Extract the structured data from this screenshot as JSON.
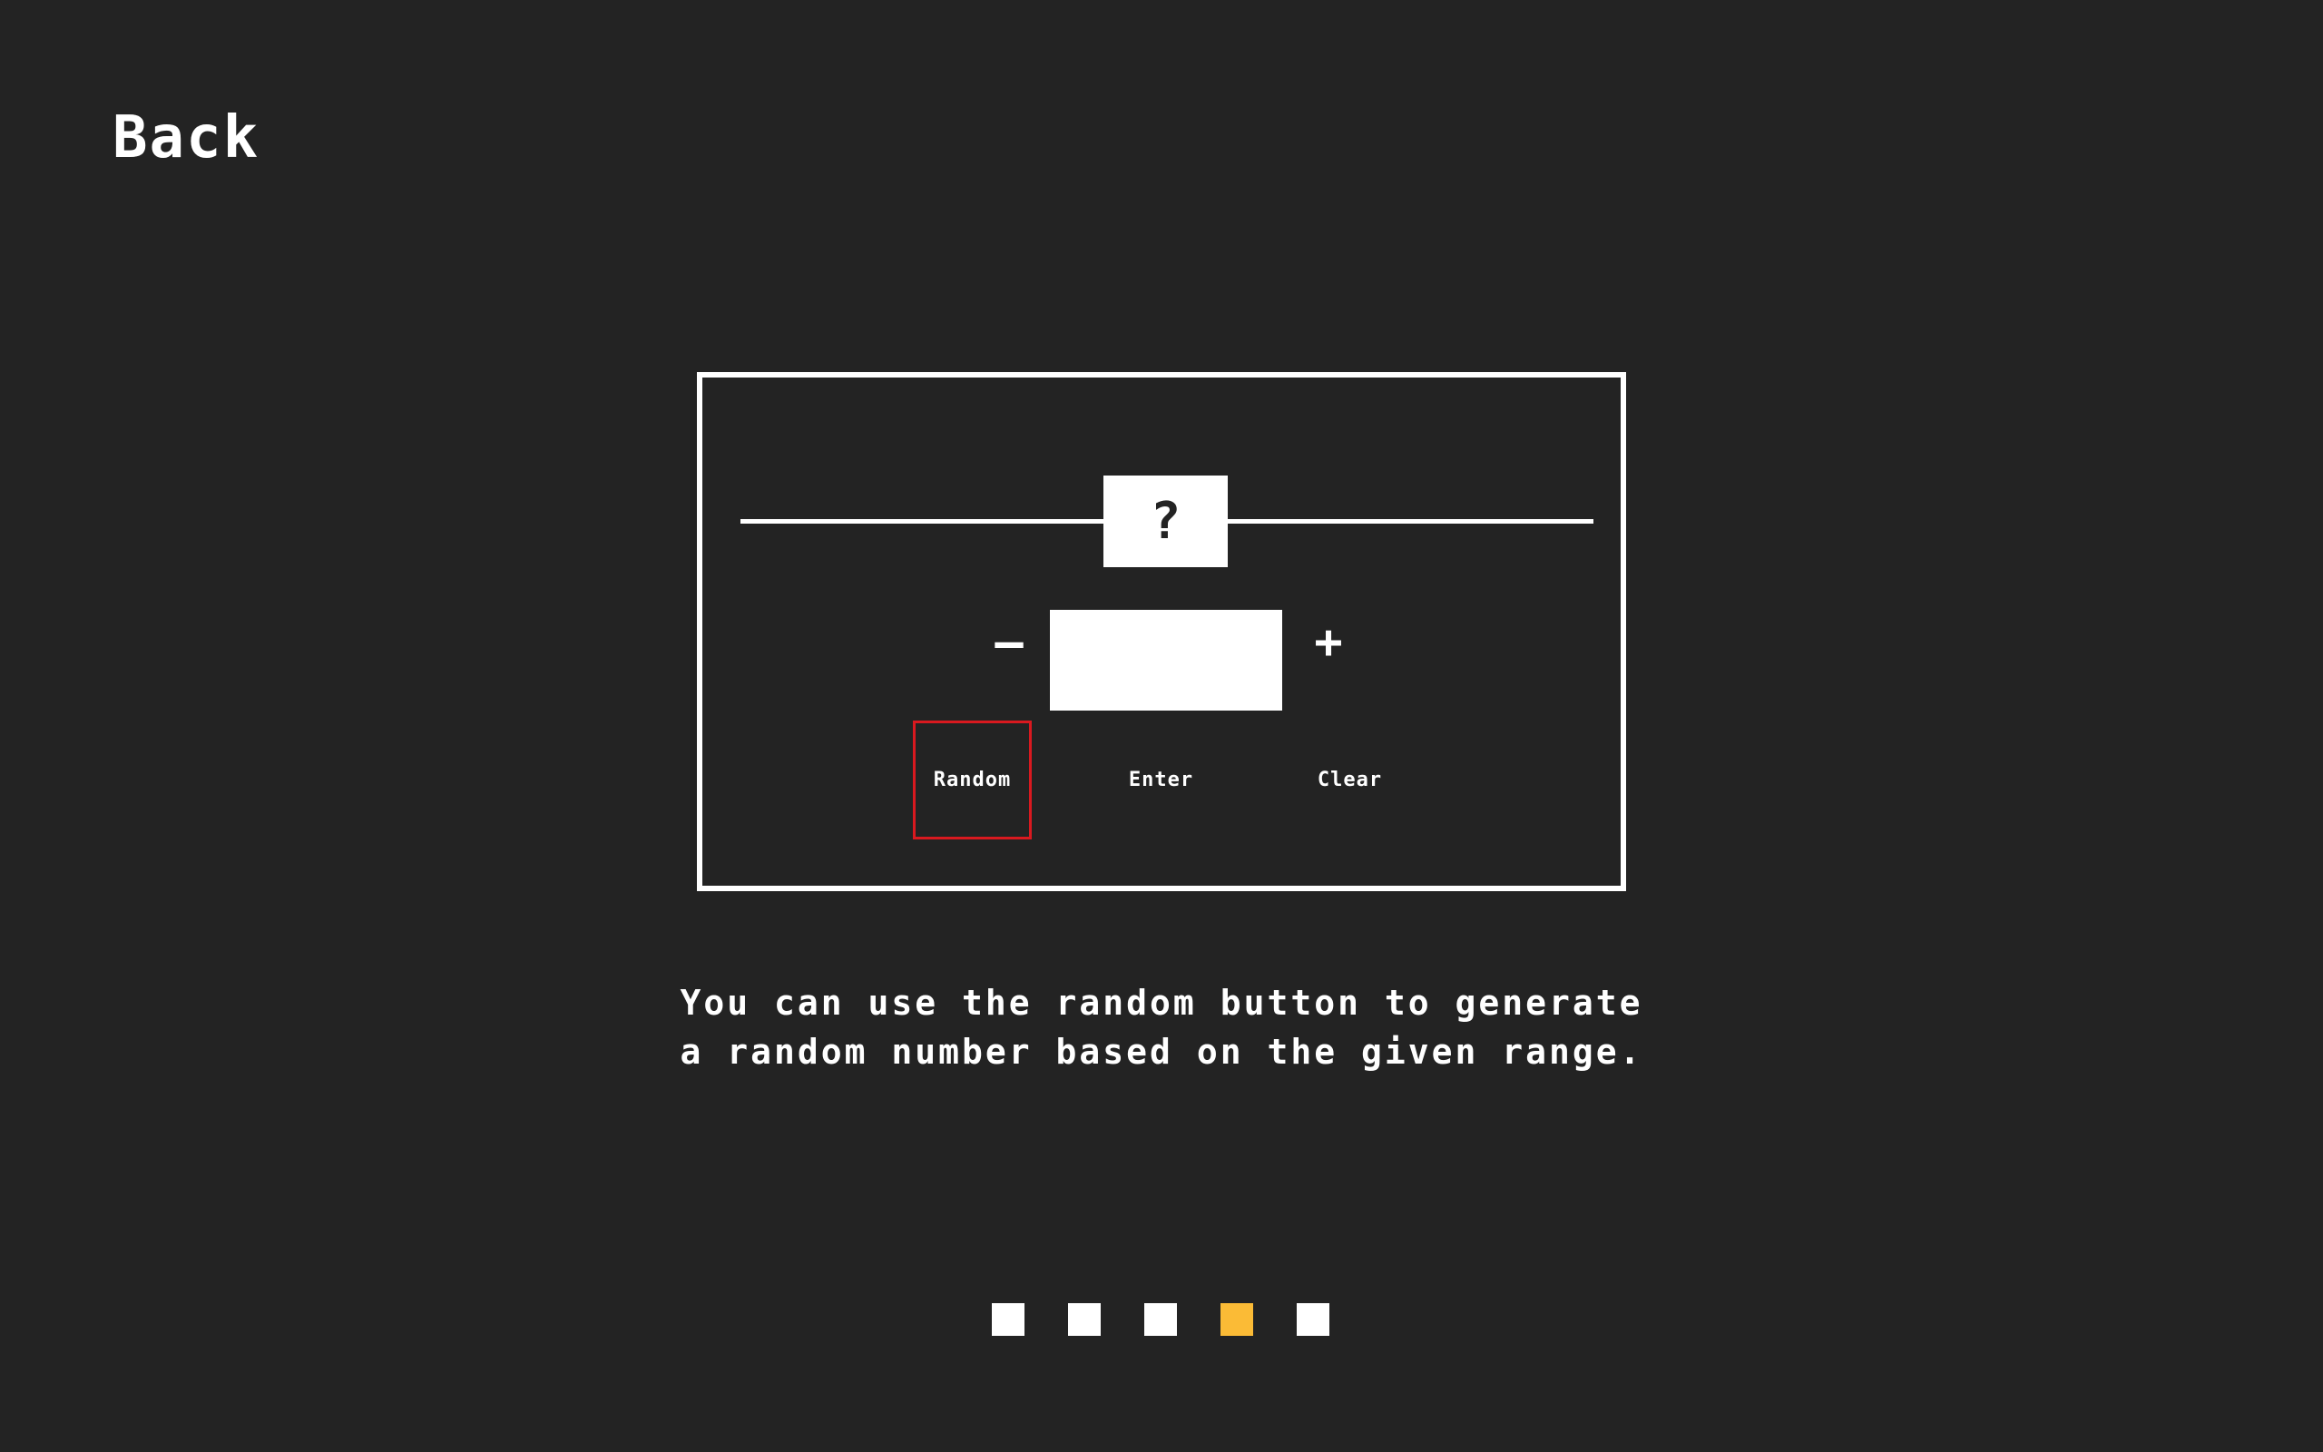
{
  "nav": {
    "back_label": "Back"
  },
  "game": {
    "range_marker": "?",
    "minus_label": "–",
    "plus_label": "+",
    "input_value": "",
    "buttons": {
      "random": "Random",
      "enter": "Enter",
      "clear": "Clear"
    },
    "highlight_color": "#d9191f"
  },
  "tutorial": {
    "line1": "You can use the random button to generate",
    "line2": "a random number based on the given range."
  },
  "pager": {
    "total": 5,
    "active_index": 3,
    "active_color": "#fbbb36",
    "inactive_color": "#ffffff"
  }
}
